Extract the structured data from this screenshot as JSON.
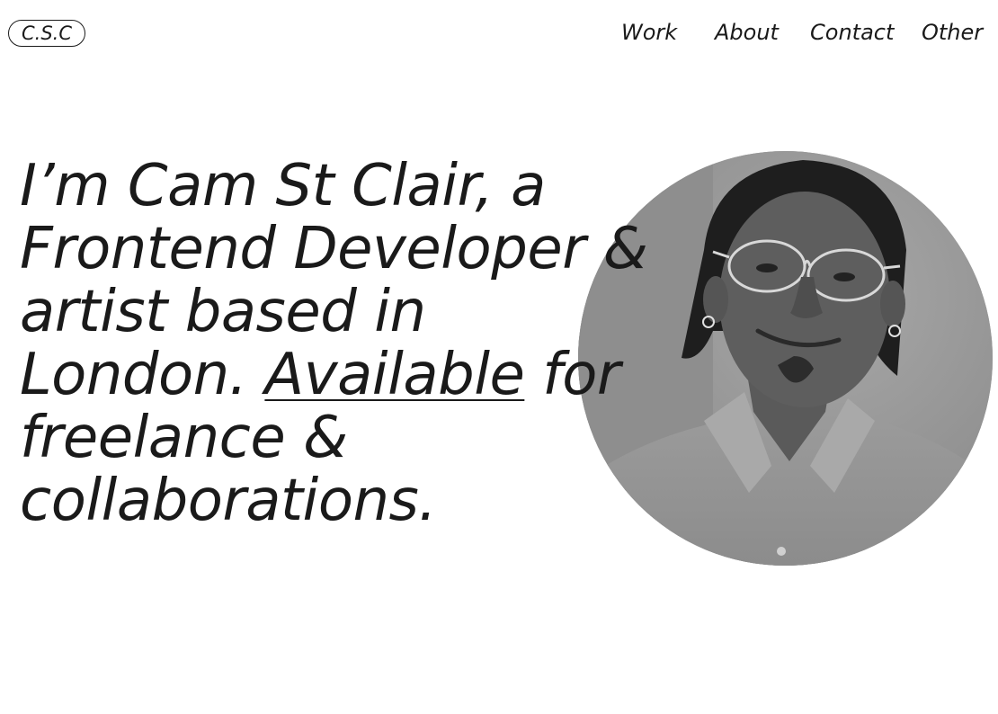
{
  "header": {
    "logo_text": "C.S.C",
    "nav": [
      {
        "label": "Work"
      },
      {
        "label": "About"
      },
      {
        "label": "Contact"
      },
      {
        "label": "Other"
      }
    ]
  },
  "hero": {
    "line1": "I’m Cam St Clair, a",
    "line2": "Frontend Developer &",
    "line3": "artist based in",
    "line4_start": "London. ",
    "line4_link": "Available",
    "line4_end": " for",
    "line5": "freelance &",
    "line6": "collaborations."
  },
  "colors": {
    "text": "#1a1a1a",
    "background": "#ffffff"
  }
}
